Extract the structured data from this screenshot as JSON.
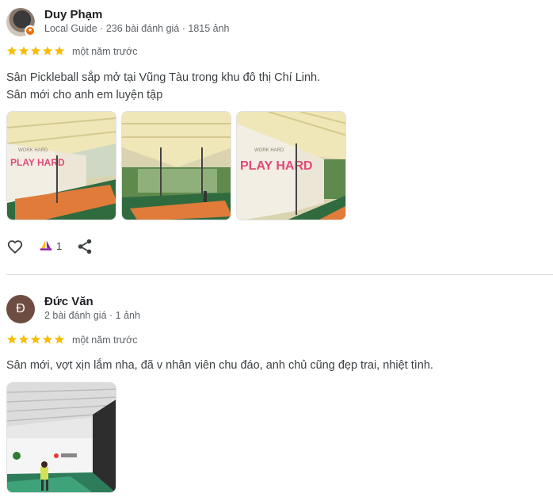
{
  "reviews": [
    {
      "name": "Duy Phạm",
      "meta": "Local Guide · 236 bài đánh giá · 1815 ảnh",
      "rating": 5,
      "date": "một năm trước",
      "text_line1": "Sân Pickleball sắp mở tại Vũng Tàu trong khu đô thị Chí Linh.",
      "text_line2": "Sân mới cho anh em luyện tập",
      "photo_count": 3,
      "reaction_count": "1"
    },
    {
      "name": "Đức Văn",
      "avatar_letter": "Đ",
      "meta": "2 bài đánh giá · 1 ảnh",
      "rating": 5,
      "date": "một năm trước",
      "text": "Sân mới, vợt xịn lắm nha, đã v nhân viên chu đáo, anh chủ cũng đẹp trai, nhiệt tình.",
      "photo_count": 1
    }
  ],
  "photo_banner_text": "PLAY HARD",
  "photo_banner_small": "WORK HARD",
  "colors": {
    "star": "#fbbc04",
    "court": "#e07b3a",
    "court_green": "#2f6b3f",
    "canopy": "#efe7b8",
    "avatar_letter_bg": "#6d4c41"
  }
}
